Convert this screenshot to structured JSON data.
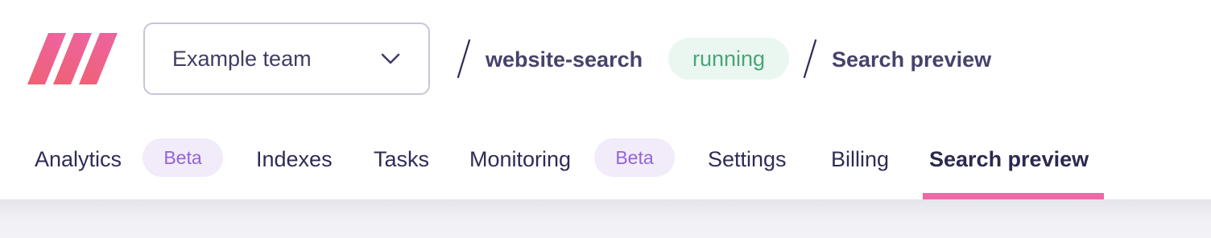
{
  "header": {
    "logo": {
      "icon": "meilisearch-logo-icon",
      "colors": [
        "#f06171",
        "#e85c8e"
      ]
    },
    "team_select": {
      "value": "Example team",
      "icon": "chevron-down-icon"
    },
    "breadcrumb": {
      "project": "website-search",
      "status": "running",
      "status_color": "#4aa477",
      "page": "Search preview"
    }
  },
  "tabs": [
    {
      "label": "Analytics",
      "badge": "Beta"
    },
    {
      "label": "Indexes"
    },
    {
      "label": "Tasks"
    },
    {
      "label": "Monitoring",
      "badge": "Beta"
    },
    {
      "label": "Settings"
    },
    {
      "label": "Billing"
    },
    {
      "label": "Search preview",
      "active": true
    }
  ],
  "colors": {
    "accent": "#ec6aa7",
    "text": "#2f2c55",
    "beta_bg": "#f1ebfa",
    "beta_text": "#9463d4"
  }
}
